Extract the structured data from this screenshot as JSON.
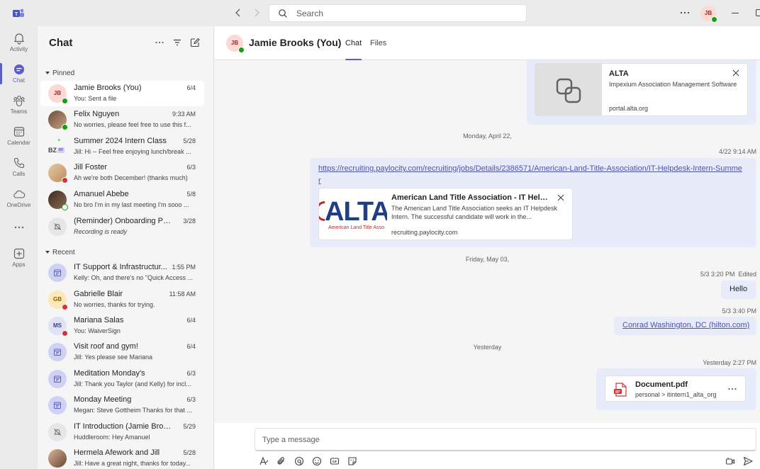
{
  "titlebar": {
    "search_placeholder": "Search",
    "user_initials": "JB"
  },
  "rail": [
    {
      "label": "Activity",
      "icon": "bell-icon"
    },
    {
      "label": "Chat",
      "icon": "chat-icon"
    },
    {
      "label": "Teams",
      "icon": "teams-icon"
    },
    {
      "label": "Calendar",
      "icon": "calendar-icon"
    },
    {
      "label": "Calls",
      "icon": "phone-icon"
    },
    {
      "label": "OneDrive",
      "icon": "cloud-icon"
    },
    {
      "label": "Apps",
      "icon": "add-app-icon"
    }
  ],
  "chatlist": {
    "title": "Chat",
    "pinned_label": "Pinned",
    "recent_label": "Recent",
    "pinned": [
      {
        "name": "Jamie Brooks (You)",
        "time": "6/4",
        "preview": "You: Sent a file",
        "initials": "JB"
      },
      {
        "name": "Felix Nguyen",
        "time": "9:33 AM",
        "preview": "No worries, please feel free to use this f..."
      },
      {
        "name": "Summer 2024 Intern Class",
        "time": "5/28",
        "preview": "Jill: Hi -- Feel free enjoying lunch/break ...",
        "initials": "BZ"
      },
      {
        "name": "Jill Foster",
        "time": "6/3",
        "preview": "Ah we're both December! (thanks much)"
      },
      {
        "name": "Amanuel Abebe",
        "time": "5/8",
        "preview": "No bro I'm in my last meeting I'm sooo ..."
      },
      {
        "name": "(Reminder) Onboarding Pro...",
        "time": "3/28",
        "preview": "Recording is ready"
      }
    ],
    "recent": [
      {
        "name": "IT Support & Infrastructur...",
        "time": "1:55 PM",
        "preview": "Kelly: Oh, and there's no \"Quick Access ..."
      },
      {
        "name": "Gabrielle Blair",
        "time": "11:58 AM",
        "preview": "No worries, thanks for trying.",
        "initials": "GB"
      },
      {
        "name": "Mariana Salas",
        "time": "6/4",
        "preview": "You: WaiverSign",
        "initials": "MS"
      },
      {
        "name": "Visit roof and gym!",
        "time": "6/4",
        "preview": "Jill: Yes please see Mariana"
      },
      {
        "name": "Meditation Monday's",
        "time": "6/3",
        "preview": "Jill: Thank you Taylor (and Kelly) for incl..."
      },
      {
        "name": "Monday Meeting",
        "time": "6/3",
        "preview": "Megan: Steve Gottheim Thanks for that ..."
      },
      {
        "name": "IT Introduction (Jamie Brooks)",
        "time": "5/29",
        "preview": "Huddleroom: Hey Amanuel"
      },
      {
        "name": "Hermela Afework and Jill",
        "time": "5/28",
        "preview": "Jill: Have a great night, thanks for today..."
      }
    ]
  },
  "conversation": {
    "name": "Jamie Brooks (You)",
    "initials": "JB",
    "tabs": [
      "Chat",
      "Files"
    ],
    "alta_card": {
      "title": "ALTA",
      "desc": "Impexium Association Management Software",
      "url": "portal.alta.org"
    },
    "date1": "Monday, April 22,",
    "msg1_time": "4/22 9:14 AM",
    "msg1_link": "https://recruiting.paylocity.com/recruiting/jobs/Details/2386571/American-Land-Title-Association/IT-Helpdesk-Intern-Summer",
    "job_card": {
      "logo_text": "ALTA",
      "logo_sub": "American Land Title Asso",
      "title": "American Land Title Association - IT Helpd...",
      "desc": "The American Land Title Association seeks an IT Helpdesk Intern. The successful candidate will work in the...",
      "url": "recruiting.paylocity.com"
    },
    "date2": "Friday, May 03,",
    "msg2_time": "5/3 3:20 PM",
    "msg2_edited": "Edited",
    "msg2_text": "Hello",
    "msg3_time": "5/3 3:40 PM",
    "msg3_link": "Conrad Washington, DC (hilton.com)",
    "date3": "Yesterday",
    "msg4_time": "Yesterday 2:27 PM",
    "file": {
      "name": "Document.pdf",
      "path": "personal > itintern1_alta_org"
    },
    "composer_placeholder": "Type a message"
  },
  "colors": {
    "accent": "#5b5fc7",
    "bubble": "#e8ebfa",
    "available": "#13a10e",
    "busy": "#d13438"
  }
}
